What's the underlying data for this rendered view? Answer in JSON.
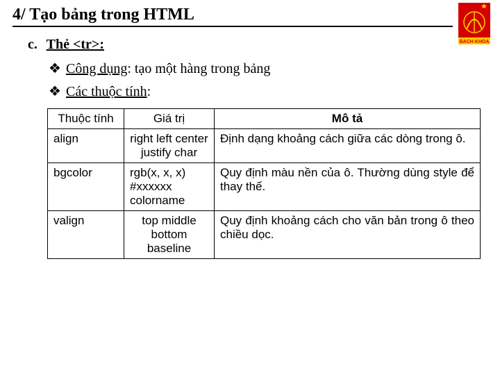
{
  "heading": "4/ Tạo bảng trong HTML",
  "section": {
    "marker": "c.",
    "title_prefix": "Thẻ ",
    "title_tag": "<tr>:",
    "bullets": [
      {
        "label": "Công dụng",
        "rest": ": tạo một hàng trong bảng"
      },
      {
        "label": "Các thuộc tính",
        "rest": ":"
      }
    ]
  },
  "table": {
    "headers": {
      "attr": "Thuộc tính",
      "val": "Giá trị",
      "desc": "Mô tả"
    },
    "rows": [
      {
        "attr": "align",
        "val": "right left center justify char",
        "desc": "Định dạng khoảng cách giữa các dòng trong ô."
      },
      {
        "attr": "bgcolor",
        "val": "rgb(x, x, x) #xxxxxx colorname",
        "desc": "Quy định màu nền của ô. Thường dùng style để thay thế."
      },
      {
        "attr": "valign",
        "val": "top middle bottom baseline",
        "desc": "Quy định khoảng cách cho văn bản trong ô theo chiều dọc."
      }
    ]
  }
}
